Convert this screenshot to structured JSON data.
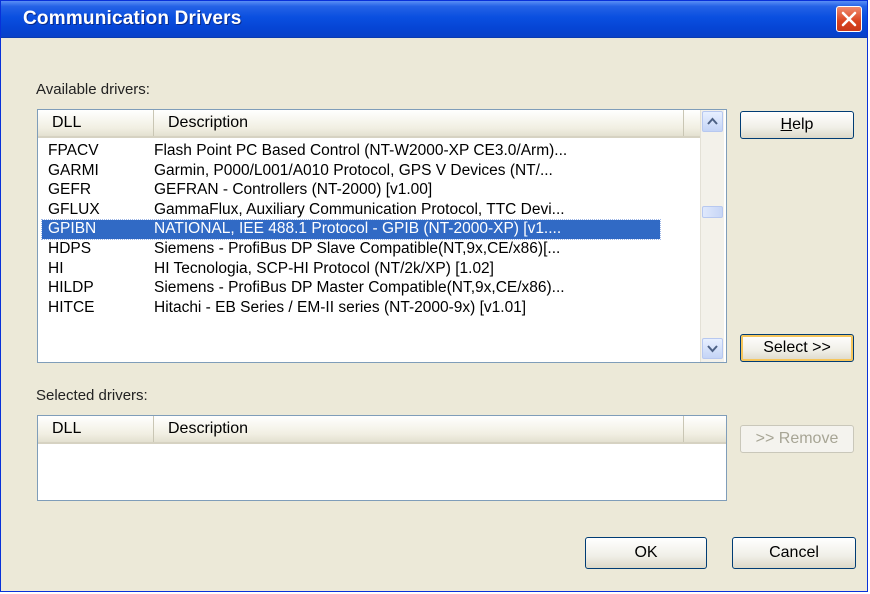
{
  "window": {
    "title": "Communication Drivers"
  },
  "available": {
    "label": "Available drivers:",
    "columns": [
      "DLL",
      "Description"
    ],
    "rows": [
      {
        "dll": "FPACV",
        "desc": "Flash Point PC Based Control (NT-W2000-XP CE3.0/Arm)..."
      },
      {
        "dll": "GARMI",
        "desc": "Garmin, P000/L001/A010 Protocol, GPS V Devices (NT/..."
      },
      {
        "dll": "GEFR",
        "desc": "GEFRAN - Controllers (NT-2000) [v1.00]"
      },
      {
        "dll": "GFLUX",
        "desc": "GammaFlux, Auxiliary Communication Protocol, TTC Devi..."
      },
      {
        "dll": "GPIBN",
        "desc": "NATIONAL, IEE 488.1 Protocol - GPIB (NT-2000-XP) [v1...."
      },
      {
        "dll": "HDPS",
        "desc": "Siemens - ProfiBus DP Slave Compatible(NT,9x,CE/x86)[..."
      },
      {
        "dll": "HI",
        "desc": "HI Tecnologia, SCP-HI Protocol (NT/2k/XP) [1.02]"
      },
      {
        "dll": "HILDP",
        "desc": "Siemens - ProfiBus DP Master Compatible(NT,9x,CE/x86)..."
      },
      {
        "dll": "HITCE",
        "desc": "Hitachi - EB Series / EM-II series (NT-2000-9x) [v1.01]"
      }
    ],
    "selected_index": 4
  },
  "selected": {
    "label": "Selected drivers:",
    "columns": [
      "DLL",
      "Description"
    ]
  },
  "buttons": {
    "help": "Help",
    "help_accel": "H",
    "help_rest": "elp",
    "select": "Select >>",
    "remove": ">> Remove",
    "ok": "OK",
    "cancel": "Cancel"
  }
}
